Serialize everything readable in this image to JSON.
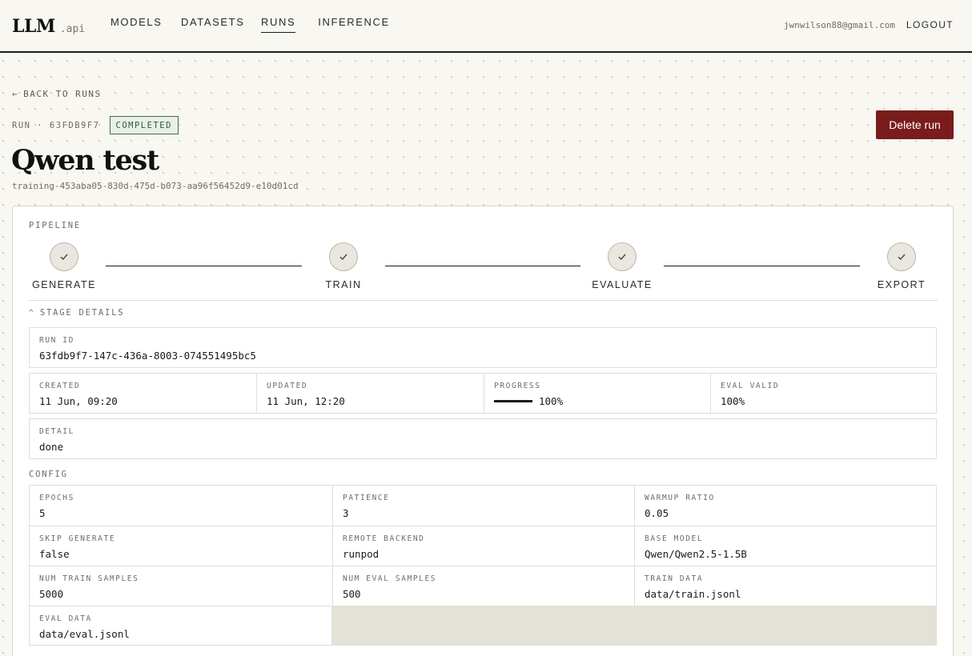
{
  "app": {
    "logo_main": "LLM",
    "logo_sub": ".api"
  },
  "nav": {
    "items": [
      {
        "label": "MODELS"
      },
      {
        "label": "DATASETS"
      },
      {
        "label": "RUNS",
        "active": true
      },
      {
        "label": "INFERENCE"
      }
    ],
    "user_email": "jwnwilson88@gmail.com",
    "logout_label": "LOGOUT"
  },
  "header": {
    "back_label": "BACK TO RUNS",
    "run_label": "RUN · 63FDB9F7",
    "status": "COMPLETED",
    "delete_label": "Delete run",
    "title": "Qwen test",
    "sub_id": "training-453aba05-830d-475d-b073-aa96f56452d9-e10d01cd"
  },
  "pipeline": {
    "label": "PIPELINE",
    "stages": [
      {
        "label": "GENERATE",
        "done": true
      },
      {
        "label": "TRAIN",
        "done": true
      },
      {
        "label": "EVALUATE",
        "done": true
      },
      {
        "label": "EXPORT",
        "done": true
      }
    ]
  },
  "stage_details": {
    "label": "STAGE DETAILS",
    "run_id_label": "RUN ID",
    "run_id": "63fdb9f7-147c-436a-8003-074551495bc5",
    "created_label": "CREATED",
    "created": "11 Jun, 09:20",
    "updated_label": "UPDATED",
    "updated": "11 Jun, 12:20",
    "progress_label": "PROGRESS",
    "progress": 1.0,
    "progress_text": "100%",
    "eval_valid_label": "EVAL VALID",
    "eval_valid": "100%",
    "detail_label": "DETAIL",
    "detail": "done"
  },
  "config": {
    "label": "CONFIG",
    "fields": [
      {
        "label": "EPOCHS",
        "value": "5"
      },
      {
        "label": "PATIENCE",
        "value": "3"
      },
      {
        "label": "WARMUP RATIO",
        "value": "0.05"
      },
      {
        "label": "SKIP GENERATE",
        "value": "false"
      },
      {
        "label": "REMOTE BACKEND",
        "value": "runpod"
      },
      {
        "label": "BASE MODEL",
        "value": "Qwen/Qwen2.5-1.5B"
      },
      {
        "label": "NUM TRAIN SAMPLES",
        "value": "5000"
      },
      {
        "label": "NUM EVAL SAMPLES",
        "value": "500"
      },
      {
        "label": "TRAIN DATA",
        "value": "data/train.jsonl"
      },
      {
        "label": "EVAL DATA",
        "value": "data/eval.jsonl"
      }
    ]
  },
  "colors": {
    "accent_danger": "#7b1c1c",
    "status_completed": "#2c5a3e",
    "background": "#f8f7f2"
  }
}
